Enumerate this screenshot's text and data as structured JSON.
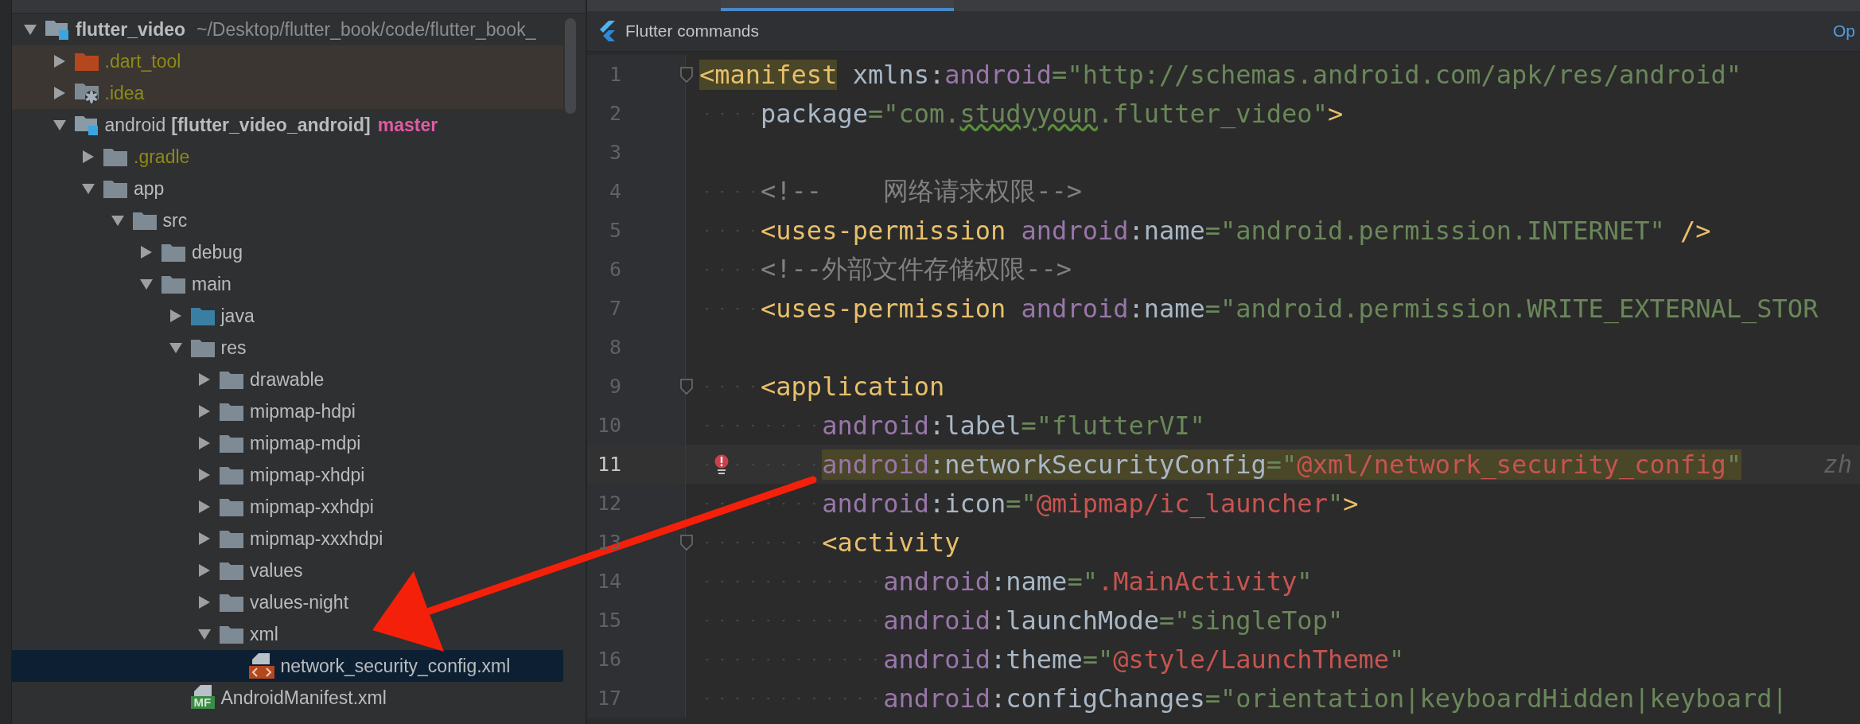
{
  "project_tree": {
    "items": [
      {
        "name": "flutter_video",
        "path": "~/Desktop/flutter_book/code/flutter_book_",
        "kind": "module",
        "expanded": true,
        "selected": false,
        "ignored": false,
        "excluded": false,
        "children": [
          {
            "name": ".dart_tool",
            "kind": "excluded",
            "expanded": false,
            "selected": false,
            "ignored": true,
            "excluded": true
          },
          {
            "name": ".idea",
            "kind": "settings",
            "expanded": false,
            "selected": false,
            "ignored": true,
            "excluded": true
          },
          {
            "name": "android",
            "module_name": "[flutter_video_android]",
            "branch": "master",
            "kind": "module",
            "expanded": true,
            "selected": false,
            "ignored": false,
            "excluded": false,
            "children": [
              {
                "name": ".gradle",
                "kind": "folder",
                "expanded": false,
                "selected": false,
                "ignored": true,
                "excluded": false
              },
              {
                "name": "app",
                "kind": "folder",
                "expanded": true,
                "selected": false,
                "ignored": false,
                "excluded": false,
                "children": [
                  {
                    "name": "src",
                    "kind": "folder",
                    "expanded": true,
                    "selected": false,
                    "ignored": false,
                    "excluded": false,
                    "children": [
                      {
                        "name": "debug",
                        "kind": "folder",
                        "expanded": false,
                        "selected": false,
                        "ignored": false,
                        "excluded": false
                      },
                      {
                        "name": "main",
                        "kind": "folder",
                        "expanded": true,
                        "selected": false,
                        "ignored": false,
                        "excluded": false,
                        "children": [
                          {
                            "name": "java",
                            "kind": "source",
                            "expanded": false,
                            "selected": false,
                            "ignored": false,
                            "excluded": false
                          },
                          {
                            "name": "res",
                            "kind": "folder",
                            "expanded": true,
                            "selected": false,
                            "ignored": false,
                            "excluded": false,
                            "children": [
                              {
                                "name": "drawable",
                                "kind": "folder",
                                "expanded": false,
                                "selected": false,
                                "ignored": false,
                                "excluded": false
                              },
                              {
                                "name": "mipmap-hdpi",
                                "kind": "folder",
                                "expanded": false,
                                "selected": false,
                                "ignored": false,
                                "excluded": false
                              },
                              {
                                "name": "mipmap-mdpi",
                                "kind": "folder",
                                "expanded": false,
                                "selected": false,
                                "ignored": false,
                                "excluded": false
                              },
                              {
                                "name": "mipmap-xhdpi",
                                "kind": "folder",
                                "expanded": false,
                                "selected": false,
                                "ignored": false,
                                "excluded": false
                              },
                              {
                                "name": "mipmap-xxhdpi",
                                "kind": "folder",
                                "expanded": false,
                                "selected": false,
                                "ignored": false,
                                "excluded": false
                              },
                              {
                                "name": "mipmap-xxxhdpi",
                                "kind": "folder",
                                "expanded": false,
                                "selected": false,
                                "ignored": false,
                                "excluded": false
                              },
                              {
                                "name": "values",
                                "kind": "folder",
                                "expanded": false,
                                "selected": false,
                                "ignored": false,
                                "excluded": false
                              },
                              {
                                "name": "values-night",
                                "kind": "folder",
                                "expanded": false,
                                "selected": false,
                                "ignored": false,
                                "excluded": false
                              },
                              {
                                "name": "xml",
                                "kind": "folder",
                                "expanded": true,
                                "selected": false,
                                "ignored": false,
                                "excluded": false,
                                "children": [
                                  {
                                    "name": "network_security_config.xml",
                                    "kind": "xml-file",
                                    "selected": true,
                                    "ignored": false,
                                    "excluded": false
                                  }
                                ]
                              }
                            ]
                          },
                          {
                            "name": "AndroidManifest.xml",
                            "kind": "manifest-file",
                            "badge": "MF",
                            "selected": false,
                            "ignored": false,
                            "excluded": false
                          }
                        ]
                      }
                    ]
                  }
                ]
              }
            ]
          }
        ]
      }
    ]
  },
  "flutter_bar": {
    "title": "Flutter commands",
    "link": "Op"
  },
  "editor": {
    "lines": [
      {
        "number": "1",
        "foldable": true,
        "current": false,
        "error": false,
        "tokens": [
          {
            "kind": "tag",
            "text": "<manifest",
            "highlight": true
          },
          {
            "kind": "plain",
            "text": " xmlns:",
            "highlight": false
          },
          {
            "kind": "ns",
            "text": "android",
            "highlight": false
          },
          {
            "kind": "string",
            "text": "=\"http://schemas.android.com/apk/res/android\"",
            "highlight": false
          }
        ]
      },
      {
        "number": "2",
        "foldable": false,
        "current": false,
        "error": false,
        "tokens": [
          {
            "kind": "plain",
            "text": "    package",
            "typo": false
          },
          {
            "kind": "string",
            "text": "=\"com.",
            "typo": false
          },
          {
            "kind": "string",
            "text": "studyyoun",
            "typo": true
          },
          {
            "kind": "string",
            "text": ".flutter_video\"",
            "typo": false
          },
          {
            "kind": "tag",
            "text": ">",
            "typo": false
          }
        ]
      },
      {
        "number": "3",
        "foldable": false,
        "current": false,
        "error": false
      },
      {
        "number": "4",
        "foldable": false,
        "current": false,
        "error": false,
        "tokens": [
          {
            "kind": "comment",
            "text": "    <!--    网络请求权限-->"
          }
        ]
      },
      {
        "number": "5",
        "foldable": false,
        "current": false,
        "error": false,
        "tokens": [
          {
            "kind": "tag",
            "text": "    <uses-permission"
          },
          {
            "kind": "ns",
            "text": " android"
          },
          {
            "kind": "plain",
            "text": ":name"
          },
          {
            "kind": "string",
            "text": "=\"android.permission.INTERNET\""
          },
          {
            "kind": "tag",
            "text": " />"
          }
        ]
      },
      {
        "number": "6",
        "foldable": false,
        "current": false,
        "error": false,
        "tokens": [
          {
            "kind": "comment",
            "text": "    <!--外部文件存储权限-->"
          }
        ]
      },
      {
        "number": "7",
        "foldable": false,
        "current": false,
        "error": false,
        "tokens": [
          {
            "kind": "tag",
            "text": "    <uses-permission"
          },
          {
            "kind": "ns",
            "text": " android"
          },
          {
            "kind": "plain",
            "text": ":name"
          },
          {
            "kind": "string",
            "text": "=\"android.permission.WRITE_EXTERNAL_STOR"
          }
        ]
      },
      {
        "number": "8",
        "foldable": false,
        "current": false,
        "error": false
      },
      {
        "number": "9",
        "foldable": true,
        "current": false,
        "error": false,
        "tokens": [
          {
            "kind": "tag",
            "text": "    <application"
          }
        ]
      },
      {
        "number": "10",
        "foldable": false,
        "current": false,
        "error": false,
        "tokens": [
          {
            "kind": "ns",
            "text": "        android"
          },
          {
            "kind": "plain",
            "text": ":label"
          },
          {
            "kind": "string",
            "text": "=\"flutterVI\""
          }
        ]
      },
      {
        "number": "11",
        "foldable": false,
        "current": true,
        "error": true,
        "hint": "zh",
        "tokens": [
          {
            "kind": "ns",
            "text": "        android",
            "highlight": true
          },
          {
            "kind": "plain",
            "text": ":networkSecurityConfig",
            "highlight": true
          },
          {
            "kind": "string",
            "text": "=\"",
            "highlight": true
          },
          {
            "kind": "ref",
            "text": "@xml/network_security_config",
            "highlight": true
          },
          {
            "kind": "string",
            "text": "\"",
            "highlight": true
          }
        ]
      },
      {
        "number": "12",
        "foldable": false,
        "current": false,
        "error": false,
        "tokens": [
          {
            "kind": "ns",
            "text": "        android"
          },
          {
            "kind": "plain",
            "text": ":icon"
          },
          {
            "kind": "string",
            "text": "=\""
          },
          {
            "kind": "ref",
            "text": "@mipmap/ic_launcher"
          },
          {
            "kind": "string",
            "text": "\""
          },
          {
            "kind": "tag",
            "text": ">"
          }
        ]
      },
      {
        "number": "13",
        "foldable": true,
        "current": false,
        "error": false,
        "tokens": [
          {
            "kind": "tag",
            "text": "        <activity"
          }
        ]
      },
      {
        "number": "14",
        "foldable": false,
        "current": false,
        "error": false,
        "tokens": [
          {
            "kind": "ns",
            "text": "            android"
          },
          {
            "kind": "plain",
            "text": ":name"
          },
          {
            "kind": "string",
            "text": "=\""
          },
          {
            "kind": "ref",
            "text": ".MainActivity"
          },
          {
            "kind": "string",
            "text": "\""
          }
        ]
      },
      {
        "number": "15",
        "foldable": false,
        "current": false,
        "error": false,
        "tokens": [
          {
            "kind": "ns",
            "text": "            android"
          },
          {
            "kind": "plain",
            "text": ":launchMode"
          },
          {
            "kind": "string",
            "text": "=\"singleTop\""
          }
        ]
      },
      {
        "number": "16",
        "foldable": false,
        "current": false,
        "error": false,
        "tokens": [
          {
            "kind": "ns",
            "text": "            android"
          },
          {
            "kind": "plain",
            "text": ":theme"
          },
          {
            "kind": "string",
            "text": "=\""
          },
          {
            "kind": "ref",
            "text": "@style/LaunchTheme"
          },
          {
            "kind": "string",
            "text": "\""
          }
        ]
      },
      {
        "number": "17",
        "foldable": false,
        "current": false,
        "error": false,
        "tokens": [
          {
            "kind": "ns",
            "text": "            android"
          },
          {
            "kind": "plain",
            "text": ":configChanges"
          },
          {
            "kind": "string",
            "text": "=\"orientation|keyboardHidden|keyboard|"
          }
        ]
      }
    ]
  }
}
